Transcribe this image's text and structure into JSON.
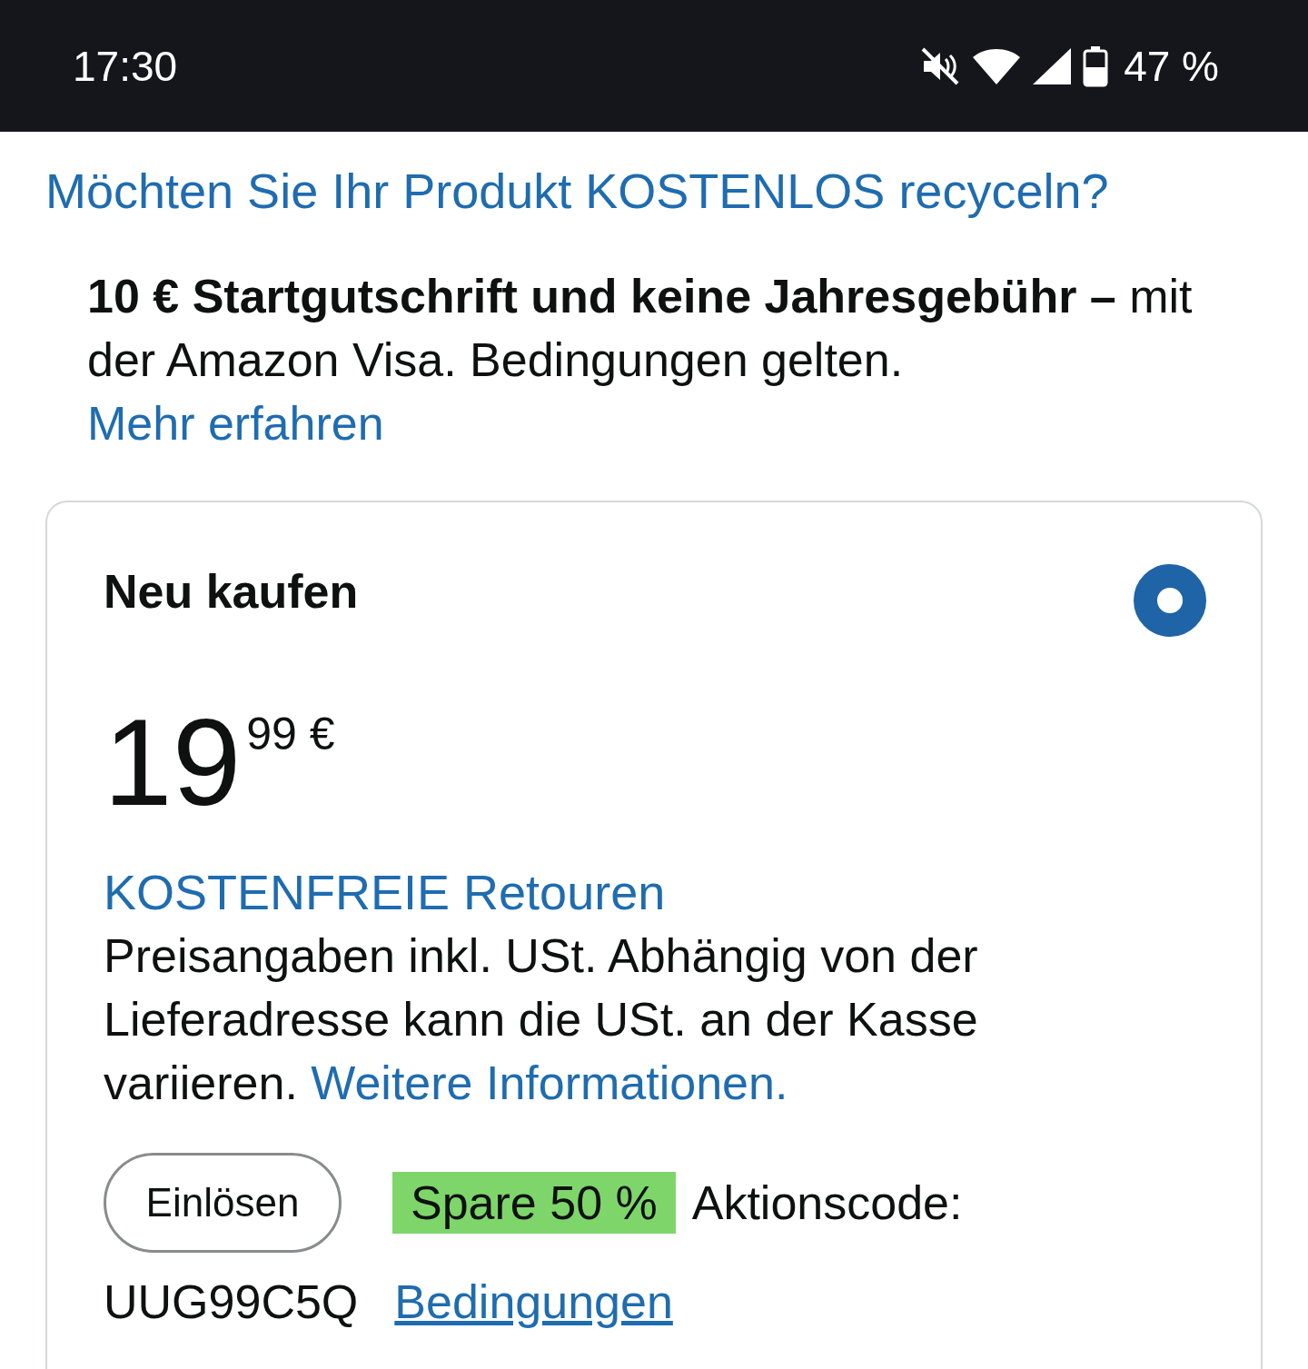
{
  "status_bar": {
    "time": "17:30",
    "battery": "47 %"
  },
  "recycle_link": "Möchten Sie Ihr Produkt KOSTENLOS recyceln?",
  "promo": {
    "text": "**10 € Startgutschrift und keine Jahresgebühr –** mit der Amazon Visa. Bedingungen gelten.",
    "link": "Mehr erfahren"
  },
  "offer": {
    "title": "Neu kaufen",
    "selected": true,
    "price_whole": "19",
    "price_superscript": "99 €",
    "returns_link": "KOSTENFREIE Retouren",
    "tax_note": "Preisangaben inkl. USt. Abhängig von der Lieferadresse kann die USt. an der Kasse variieren.",
    "tax_link": "Weitere Informationen.",
    "redeem_button": "Einlösen",
    "badge": "Spare 50 %",
    "promo_label": "Aktionscode:",
    "code": "UUG99C5Q",
    "terms_link": "Bedingungen"
  }
}
